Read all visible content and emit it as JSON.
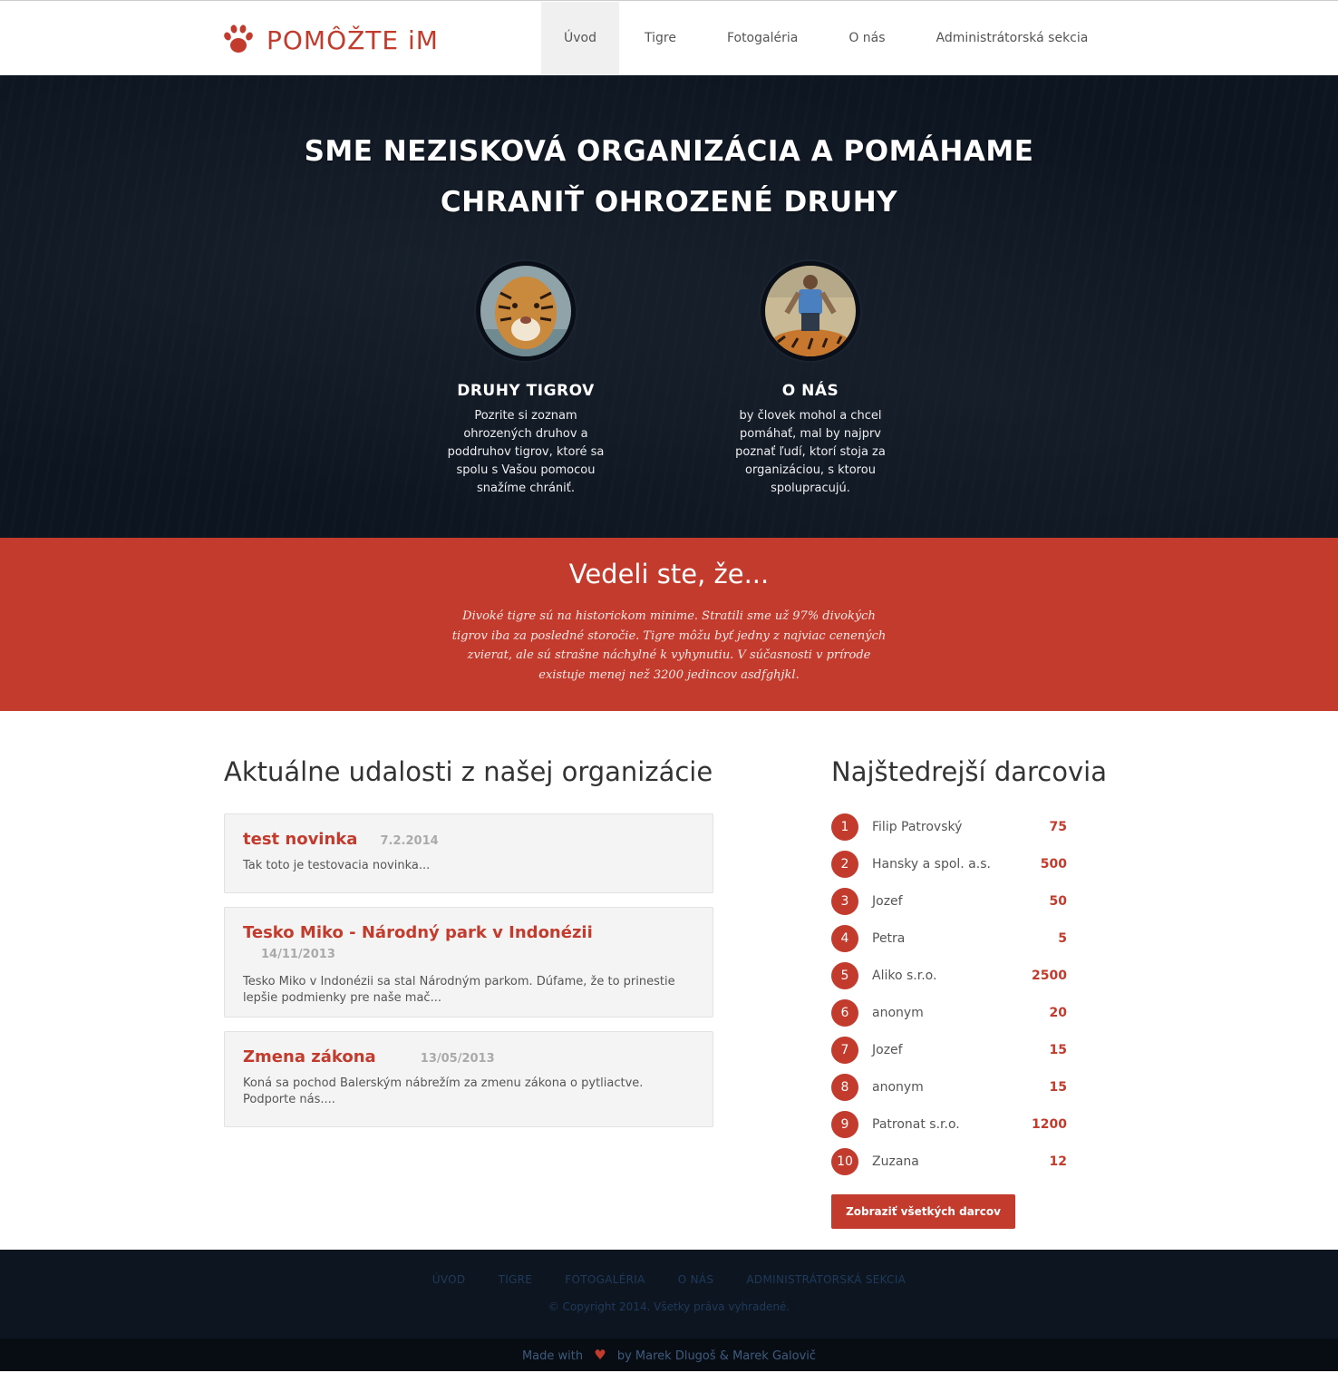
{
  "brand": {
    "logo_text": "POMÔŽTE iM",
    "accent_color": "#c23b2d",
    "dark_color": "#0d1521"
  },
  "nav": {
    "items": [
      {
        "label": "Úvod",
        "active": true
      },
      {
        "label": "Tigre"
      },
      {
        "label": "Fotogaléria"
      },
      {
        "label": "O nás"
      },
      {
        "label": "Administrátorská sekcia"
      }
    ]
  },
  "hero": {
    "title_line1": "SME NEZISKOVÁ ORGANIZÁCIA A POMÁHAME",
    "title_line2": "CHRANIŤ OHROZENÉ DRUHY",
    "features": [
      {
        "icon": "tiger-photo",
        "title": "DRUHY TIGROV",
        "text": "Pozrite si zoznam ohrozených druhov a poddruhov tigrov, ktoré sa spolu s Vašou pomocou snažíme chrániť."
      },
      {
        "icon": "person-with-tiger-photo",
        "title": "O NÁS",
        "text": "by človek mohol a chcel pomáhať, mal by najprv poznať ľudí, ktorí stoja za organizáciou, s ktorou spolupracujú."
      }
    ]
  },
  "fact": {
    "title": "Vedeli ste, že...",
    "text": "Divoké tigre sú na historickom minime. Stratili sme už 97% divokých tigrov iba za posledné storočie. Tigre môžu byť jedny z najviac cenených zvierat, ale sú strašne náchylné k vyhynutiu. V súčasnosti v prírode existuje menej než 3200 jedincov asdfghjkl."
  },
  "news": {
    "heading": "Aktuálne udalosti z našej organizácie",
    "items": [
      {
        "title": "test novinka",
        "date": "7.2.2014",
        "text": "Tak toto je testovacia novinka..."
      },
      {
        "title": "Tesko Miko - Národný park v Indonézii",
        "date": "14/11/2013",
        "text": "Tesko Miko v Indonézii sa stal Národným parkom. Dúfame, že to prinestie lepšie podmienky pre naše mač..."
      },
      {
        "title": "Zmena zákona",
        "date": "13/05/2013",
        "text": "Koná sa pochod Balerským nábrežím za zmenu zákona o pytliactve. Podporte nás...."
      }
    ]
  },
  "donors": {
    "heading": "Najštedrejší darcovia",
    "items": [
      {
        "rank": "1",
        "name": "Filip Patrovský",
        "amount": "75"
      },
      {
        "rank": "2",
        "name": "Hansky a spol. a.s.",
        "amount": "500"
      },
      {
        "rank": "3",
        "name": "Jozef",
        "amount": "50"
      },
      {
        "rank": "4",
        "name": "Petra",
        "amount": "5"
      },
      {
        "rank": "5",
        "name": "Aliko s.r.o.",
        "amount": "2500"
      },
      {
        "rank": "6",
        "name": "anonym",
        "amount": "20"
      },
      {
        "rank": "7",
        "name": "Jozef",
        "amount": "15"
      },
      {
        "rank": "8",
        "name": "anonym",
        "amount": "15"
      },
      {
        "rank": "9",
        "name": "Patronat s.r.o.",
        "amount": "1200"
      },
      {
        "rank": "10",
        "name": "Zuzana",
        "amount": "12"
      }
    ],
    "button_label": "Zobraziť všetkých darcov"
  },
  "footer": {
    "links": [
      "ÚVOD",
      "TIGRE",
      "FOTOGALÉRIA",
      "O NÁS",
      "ADMINISTRÁTORSKÁ SEKCIA"
    ],
    "copyright": "© Copyright 2014. Všetky práva vyhradené.",
    "credits_prefix": "Made with",
    "credits_icon": "heart-icon",
    "credits_suffix": "by Marek Dlugoš & Marek Galovič"
  }
}
